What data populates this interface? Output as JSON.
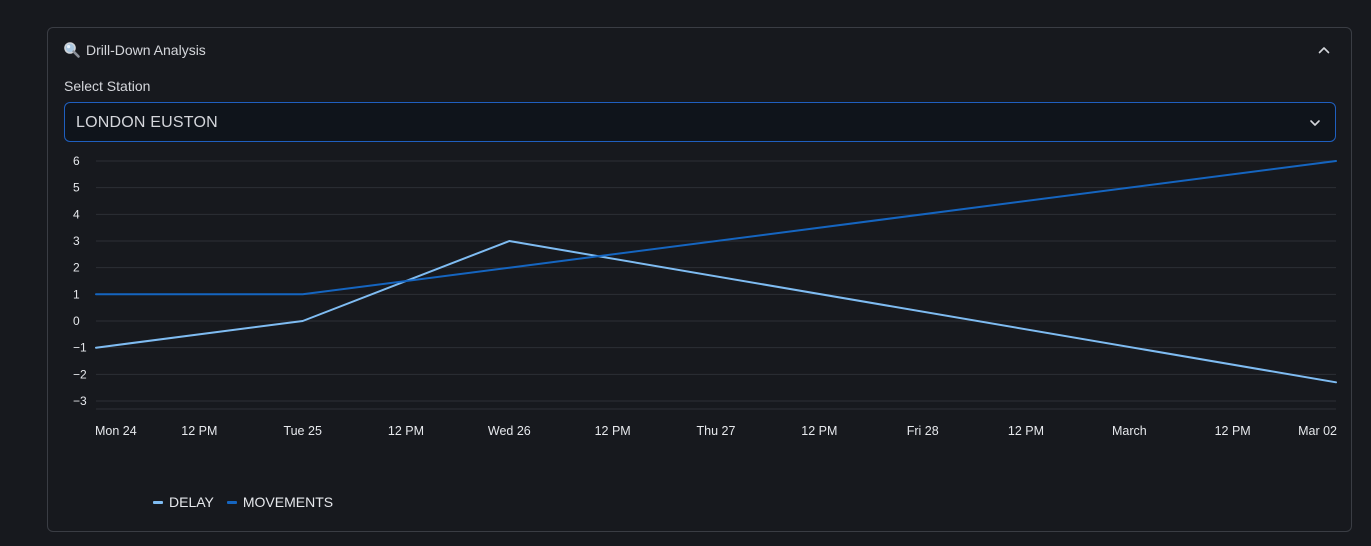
{
  "panel": {
    "title": "Drill-Down Analysis",
    "icon": "magnifier-icon",
    "collapse_icon": "chevron-up-icon"
  },
  "station_select": {
    "label": "Select Station",
    "value": "LONDON EUSTON",
    "chevron_icon": "chevron-down-icon"
  },
  "colors": {
    "delay": "#7fbcf2",
    "movements": "#1565c0",
    "select_border": "#1f5fbf",
    "grid": "#2c2f36"
  },
  "chart_data": {
    "type": "line",
    "title": "",
    "xlabel": "",
    "ylabel": "",
    "x_ticks": [
      "Mon 24",
      "12 PM",
      "Tue 25",
      "12 PM",
      "Wed 26",
      "12 PM",
      "Thu 27",
      "12 PM",
      "Fri 28",
      "12 PM",
      "March",
      "12 PM",
      "Mar 02"
    ],
    "y_ticks": [
      6,
      5,
      4,
      3,
      2,
      1,
      0,
      -1,
      -2,
      -3
    ],
    "ylim": [
      -3.3,
      6
    ],
    "grid": true,
    "legend_position": "bottom-left",
    "series": [
      {
        "name": "DELAY",
        "color": "#7fbcf2",
        "x": [
          "Mon 24",
          "Tue 25",
          "Wed 26",
          "Mar 02"
        ],
        "values": [
          -1,
          0,
          3,
          -2.3
        ]
      },
      {
        "name": "MOVEMENTS",
        "color": "#1565c0",
        "x": [
          "Mon 24",
          "Tue 25",
          "Wed 26",
          "Mar 02"
        ],
        "values": [
          1,
          1,
          2,
          6
        ]
      }
    ]
  }
}
